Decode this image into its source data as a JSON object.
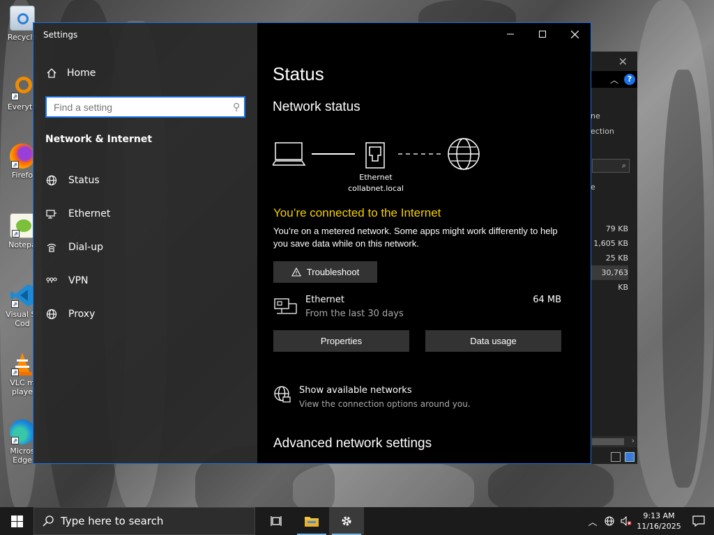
{
  "desktop": {
    "icons": [
      {
        "label": "Recycle",
        "name": "recycle-bin"
      },
      {
        "label": "Everyth",
        "name": "everything"
      },
      {
        "label": "Firefo",
        "name": "firefox"
      },
      {
        "label": "Notepa",
        "name": "notepad-plus-plus"
      },
      {
        "label": "Visual St\nCod",
        "name": "visual-studio-code"
      },
      {
        "label": "VLC m\nplaye",
        "name": "vlc"
      },
      {
        "label": "Micros\nEdge",
        "name": "edge"
      }
    ]
  },
  "explorer_bg": {
    "close": "✕",
    "side_text_1": "ne",
    "side_text_2": "ection",
    "search_glyph": "⌕",
    "column_fragment": "e",
    "sizes": [
      "79 KB",
      "1,605 KB",
      "25 KB",
      "30,763 KB"
    ]
  },
  "settings": {
    "app_title": "Settings",
    "home_label": "Home",
    "search_placeholder": "Find a setting",
    "section_title": "Network & Internet",
    "nav": [
      {
        "label": "Status",
        "icon": "globe-icon"
      },
      {
        "label": "Ethernet",
        "icon": "ethernet-icon"
      },
      {
        "label": "Dial-up",
        "icon": "dialup-icon"
      },
      {
        "label": "VPN",
        "icon": "vpn-icon"
      },
      {
        "label": "Proxy",
        "icon": "globe-icon"
      }
    ],
    "page_title": "Status",
    "network_status_title": "Network status",
    "adapter_name": "Ethernet",
    "domain_name": "collabnet.local",
    "connected_text": "You’re connected to the Internet",
    "metered_text": "You’re on a metered network. Some apps might work differently to help you save data while on this network.",
    "troubleshoot_label": "Troubleshoot",
    "ethernet_label": "Ethernet",
    "ethernet_sub": "From the last 30 days",
    "ethernet_usage": "64 MB",
    "properties_label": "Properties",
    "data_usage_label": "Data usage",
    "show_networks_label": "Show available networks",
    "show_networks_sub": "View the connection options around you.",
    "advanced_title": "Advanced network settings"
  },
  "taskbar": {
    "search_placeholder": "Type here to search",
    "time": "9:13 AM",
    "date": "11/16/2025"
  },
  "colors": {
    "accent": "#1a73e8",
    "connected_yellow": "#f5d000",
    "settings_right_bg": "#000000",
    "taskbar_bg": "#1b1b1b"
  }
}
